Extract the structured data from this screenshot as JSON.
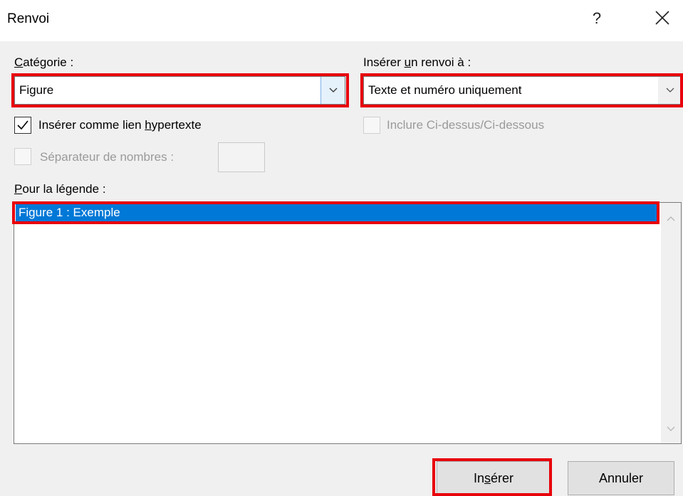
{
  "window": {
    "title": "Renvoi",
    "help_label": "?",
    "close_icon": "close-icon"
  },
  "category": {
    "label_prefix": "",
    "label_mnemonic": "C",
    "label_rest": "atégorie :",
    "value": "Figure"
  },
  "reference": {
    "label_prefix": "Insérer ",
    "label_mnemonic": "u",
    "label_rest": "n renvoi à :",
    "value": "Texte et numéro uniquement"
  },
  "options": {
    "hyperlink": {
      "label_prefix": "Insérer comme lien ",
      "label_mnemonic": "h",
      "label_rest": "ypertexte",
      "checked": true
    },
    "above_below": {
      "label": "Inclure Ci-dessus/Ci-dessous",
      "checked": false,
      "enabled": false
    },
    "separator": {
      "label": "Séparateur de nombres :",
      "checked": false,
      "enabled": false,
      "value": ""
    }
  },
  "legend": {
    "label_mnemonic": "P",
    "label_rest": "our la légende :",
    "items": [
      "Figure 1 : Exemple"
    ],
    "selected_index": 0
  },
  "buttons": {
    "insert_prefix": "In",
    "insert_mnemonic": "s",
    "insert_rest": "érer",
    "cancel": "Annuler"
  },
  "colors": {
    "highlight_red": "#e8000b",
    "selection_blue": "#0078d7"
  }
}
